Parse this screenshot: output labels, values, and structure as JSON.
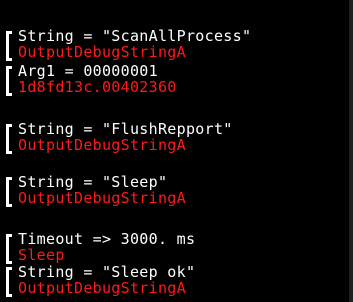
{
  "theme": {
    "background": "#000000",
    "text_color": "#ffffff",
    "api_color": "#ff1a1a"
  },
  "trace": [
    {
      "lines": [
        {
          "text": "String = \"ScanAllProcess\"",
          "kind": "param"
        },
        {
          "text": "OutputDebugStringA",
          "kind": "api"
        }
      ]
    },
    {
      "lines": [
        {
          "text": "Arg1 = 00000001",
          "kind": "param"
        },
        {
          "text": "1d8fd13c.00402360",
          "kind": "api"
        }
      ]
    },
    {
      "lines": [
        {
          "text": "String = \"FlushRepport\"",
          "kind": "param"
        },
        {
          "text": "OutputDebugStringA",
          "kind": "api"
        }
      ]
    },
    {
      "lines": [
        {
          "text": "String = \"Sleep\"",
          "kind": "param"
        },
        {
          "text": "OutputDebugStringA",
          "kind": "api"
        }
      ]
    },
    {
      "lines": [
        {
          "text": "Timeout => 3000. ms",
          "kind": "param"
        },
        {
          "text": "Sleep",
          "kind": "api"
        }
      ]
    },
    {
      "lines": [
        {
          "text": "String = \"Sleep ok\"",
          "kind": "param"
        },
        {
          "text": "OutputDebugStringA",
          "kind": "api"
        }
      ]
    }
  ]
}
